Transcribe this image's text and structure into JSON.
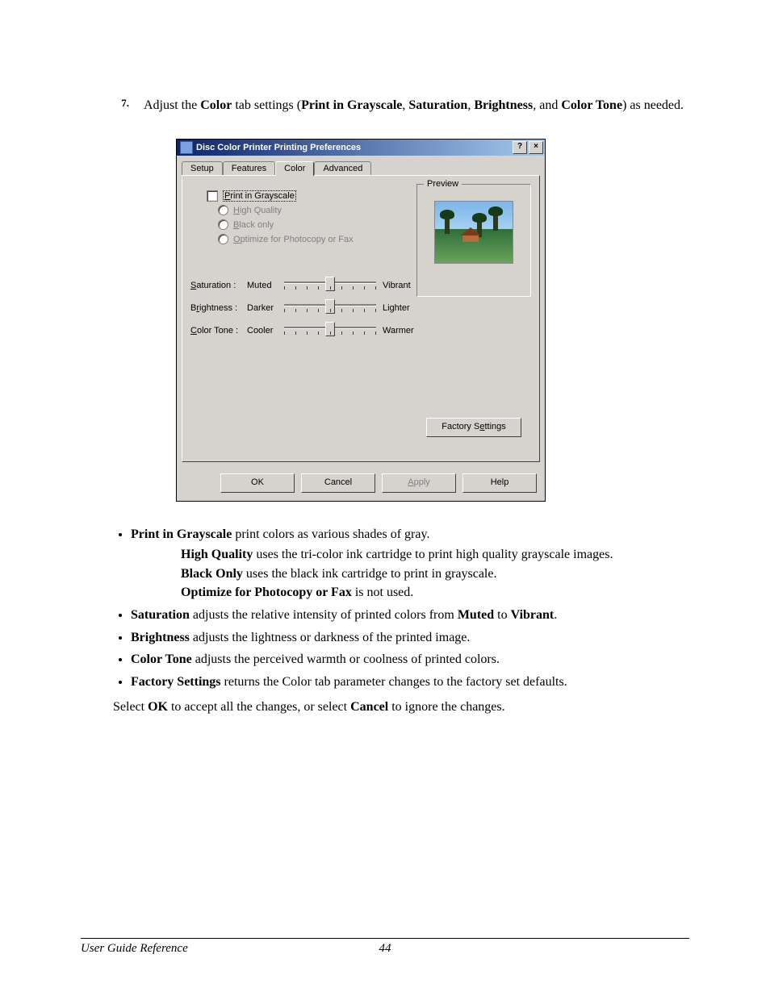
{
  "step": {
    "number": "7.",
    "t1": "Adjust the ",
    "b1": "Color",
    "t2": " tab settings (",
    "b2": "Print in Grayscale",
    "t3": ", ",
    "b3": "Saturation",
    "t4": ", ",
    "b4": "Brightness",
    "t5": ", and ",
    "b5": "Color Tone",
    "t6": ") as needed."
  },
  "dialog": {
    "title": "Disc Color Printer Printing Preferences",
    "help_glyph": "?",
    "close_glyph": "×",
    "tabs": {
      "setup": "Setup",
      "features": "Features",
      "color": "Color",
      "advanced": "Advanced"
    },
    "grayscale": {
      "checkbox": "Print in Grayscale",
      "high_quality": "High Quality",
      "black_only": "Black only",
      "optimize": "Optimize for Photocopy or Fax"
    },
    "sliders": {
      "saturation": {
        "label": "Saturation :",
        "left": "Muted",
        "right": "Vibrant"
      },
      "brightness": {
        "label": "Brightness :",
        "left": "Darker",
        "right": "Lighter"
      },
      "colortone": {
        "label": "Color Tone :",
        "left": "Cooler",
        "right": "Warmer"
      }
    },
    "preview_label": "Preview",
    "factory": "Factory Settings",
    "buttons": {
      "ok": "OK",
      "cancel": "Cancel",
      "apply": "Apply",
      "help": "Help"
    }
  },
  "bullets": {
    "grayscale": {
      "b": "Print in Grayscale",
      "t": " print colors as various shades of gray."
    },
    "sub_hq": {
      "b": "High Quality",
      "t": " uses the tri-color ink cartridge to print high quality grayscale images."
    },
    "sub_bo": {
      "b": "Black Only",
      "t": " uses the black ink cartridge to print in grayscale."
    },
    "sub_opt": {
      "b": "Optimize for Photocopy or Fax",
      "t": " is not used."
    },
    "saturation": {
      "b": "Saturation",
      "t1": " adjusts the relative intensity of printed colors from ",
      "b2": "Muted",
      "t2": " to ",
      "b3": "Vibrant",
      "t3": "."
    },
    "brightness": {
      "b": "Brightness",
      "t": " adjusts the lightness or darkness of the printed image."
    },
    "colortone": {
      "b": "Color Tone",
      "t": " adjusts the perceived warmth or coolness of printed colors."
    },
    "factory": {
      "b": "Factory Settings",
      "t": " returns the Color tab parameter changes to the factory set defaults."
    }
  },
  "closing": {
    "t1": "Select ",
    "b1": "OK",
    "t2": " to accept all the changes, or select ",
    "b2": "Cancel",
    "t3": " to ignore the changes."
  },
  "footer": {
    "left": "User Guide Reference",
    "page": "44"
  }
}
